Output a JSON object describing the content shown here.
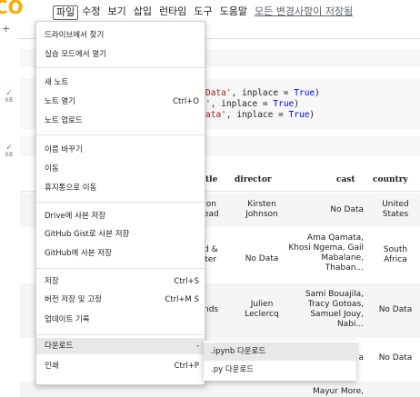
{
  "app": {
    "logo_text": "CO"
  },
  "menubar": {
    "items": [
      "파일",
      "수정",
      "보기",
      "삽입",
      "런타임",
      "도구",
      "도움말"
    ],
    "saved_status": "모든 변경사항이 저장됨"
  },
  "toolbar": {
    "add": "+"
  },
  "cells": {
    "status1": "0초",
    "status2": "0초",
    "code_lines": [
      [
        "Data'",
        ", inplace = ",
        "True",
        ")"
      ],
      [
        "'",
        ", inplace = ",
        "True",
        ")"
      ],
      [
        "ata'",
        ", inplace = ",
        "True",
        ")"
      ]
    ]
  },
  "table": {
    "headers": [
      "tle",
      "director",
      "cast",
      "country"
    ],
    "rows": [
      {
        "title": "on\nead",
        "director": "Kirsten\nJohnson",
        "cast": "No Data",
        "country": "United\nStates"
      },
      {
        "title": "d &\nter",
        "director": "No Data",
        "cast": "Ama Qamata,\nKhosi Ngema, Gail\nMabalane,\nThaban...",
        "country": "South\nAfrica"
      },
      {
        "title": "nds",
        "director": "Julien\nLeclercq",
        "cast": "Sami Bouajila,\nTracy Gotoas,\nSamuel Jouy,\nNabi...",
        "country": "No Data"
      },
      {
        "title": "",
        "director": "",
        "cast": "a",
        "country": "No Data"
      },
      {
        "title": "",
        "director": "",
        "cast": "Mayur More,",
        "country": ""
      }
    ]
  },
  "file_menu": {
    "groups": [
      [
        {
          "label": "드라이브에서 찾기",
          "shortcut": ""
        },
        {
          "label": "실습 모드에서 열기",
          "shortcut": ""
        }
      ],
      [
        {
          "label": "새 노트",
          "shortcut": ""
        },
        {
          "label": "노트 열기",
          "shortcut": "Ctrl+O"
        },
        {
          "label": "노트 업로드",
          "shortcut": ""
        }
      ],
      [
        {
          "label": "이름 바꾸기",
          "shortcut": ""
        },
        {
          "label": "이동",
          "shortcut": ""
        },
        {
          "label": "휴지통으로 이동",
          "shortcut": ""
        }
      ],
      [
        {
          "label": "Drive에 사본 저장",
          "shortcut": ""
        },
        {
          "label": "GitHub Gist로 사본 저장",
          "shortcut": ""
        },
        {
          "label": "GitHub에 사본 저장",
          "shortcut": ""
        }
      ],
      [
        {
          "label": "저장",
          "shortcut": "Ctrl+S"
        },
        {
          "label": "버전 저장 및 고정",
          "shortcut": "Ctrl+M S"
        },
        {
          "label": "업데이트 기록",
          "shortcut": ""
        }
      ],
      [
        {
          "label": "다운로드",
          "shortcut": "-"
        },
        {
          "label": "인쇄",
          "shortcut": "Ctrl+P"
        }
      ]
    ],
    "highlighted": "다운로드"
  },
  "download_submenu": {
    "items": [
      ".ipynb 다운로드",
      ".py 다운로드"
    ],
    "highlighted": ".ipynb 다운로드"
  }
}
